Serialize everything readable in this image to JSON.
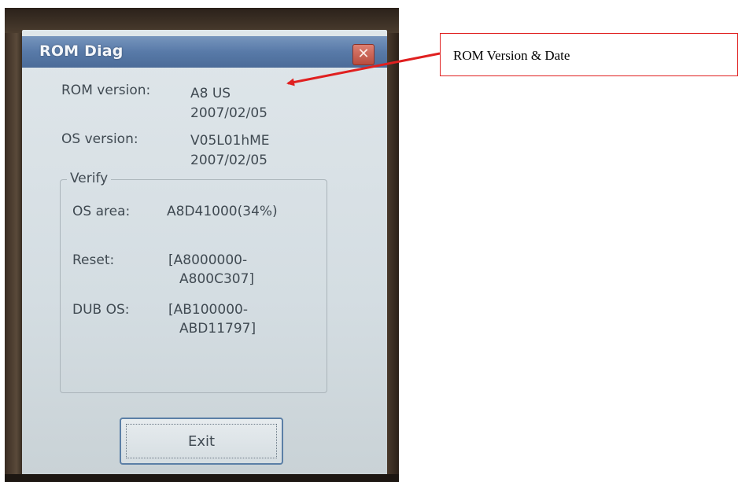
{
  "window": {
    "title": "ROM Diag",
    "close_symbol": "✕"
  },
  "rom": {
    "label": "ROM version:",
    "value_line1": "A8 US",
    "value_line2": "2007/02/05"
  },
  "os": {
    "label": "OS version:",
    "value_line1": "V05L01hME",
    "value_line2": "2007/02/05"
  },
  "verify": {
    "legend": "Verify",
    "os_area_label": "OS area:",
    "os_area_value": "A8D41000(34%)",
    "reset_label": "Reset:",
    "reset_value_line1": "[A8000000-",
    "reset_value_line2": "A800C307]",
    "dub_label": "DUB OS:",
    "dub_value_line1": "[AB100000-",
    "dub_value_line2": "ABD11797]"
  },
  "buttons": {
    "exit": "Exit"
  },
  "annotation": {
    "text": "ROM Version & Date",
    "color": "#e02020"
  }
}
